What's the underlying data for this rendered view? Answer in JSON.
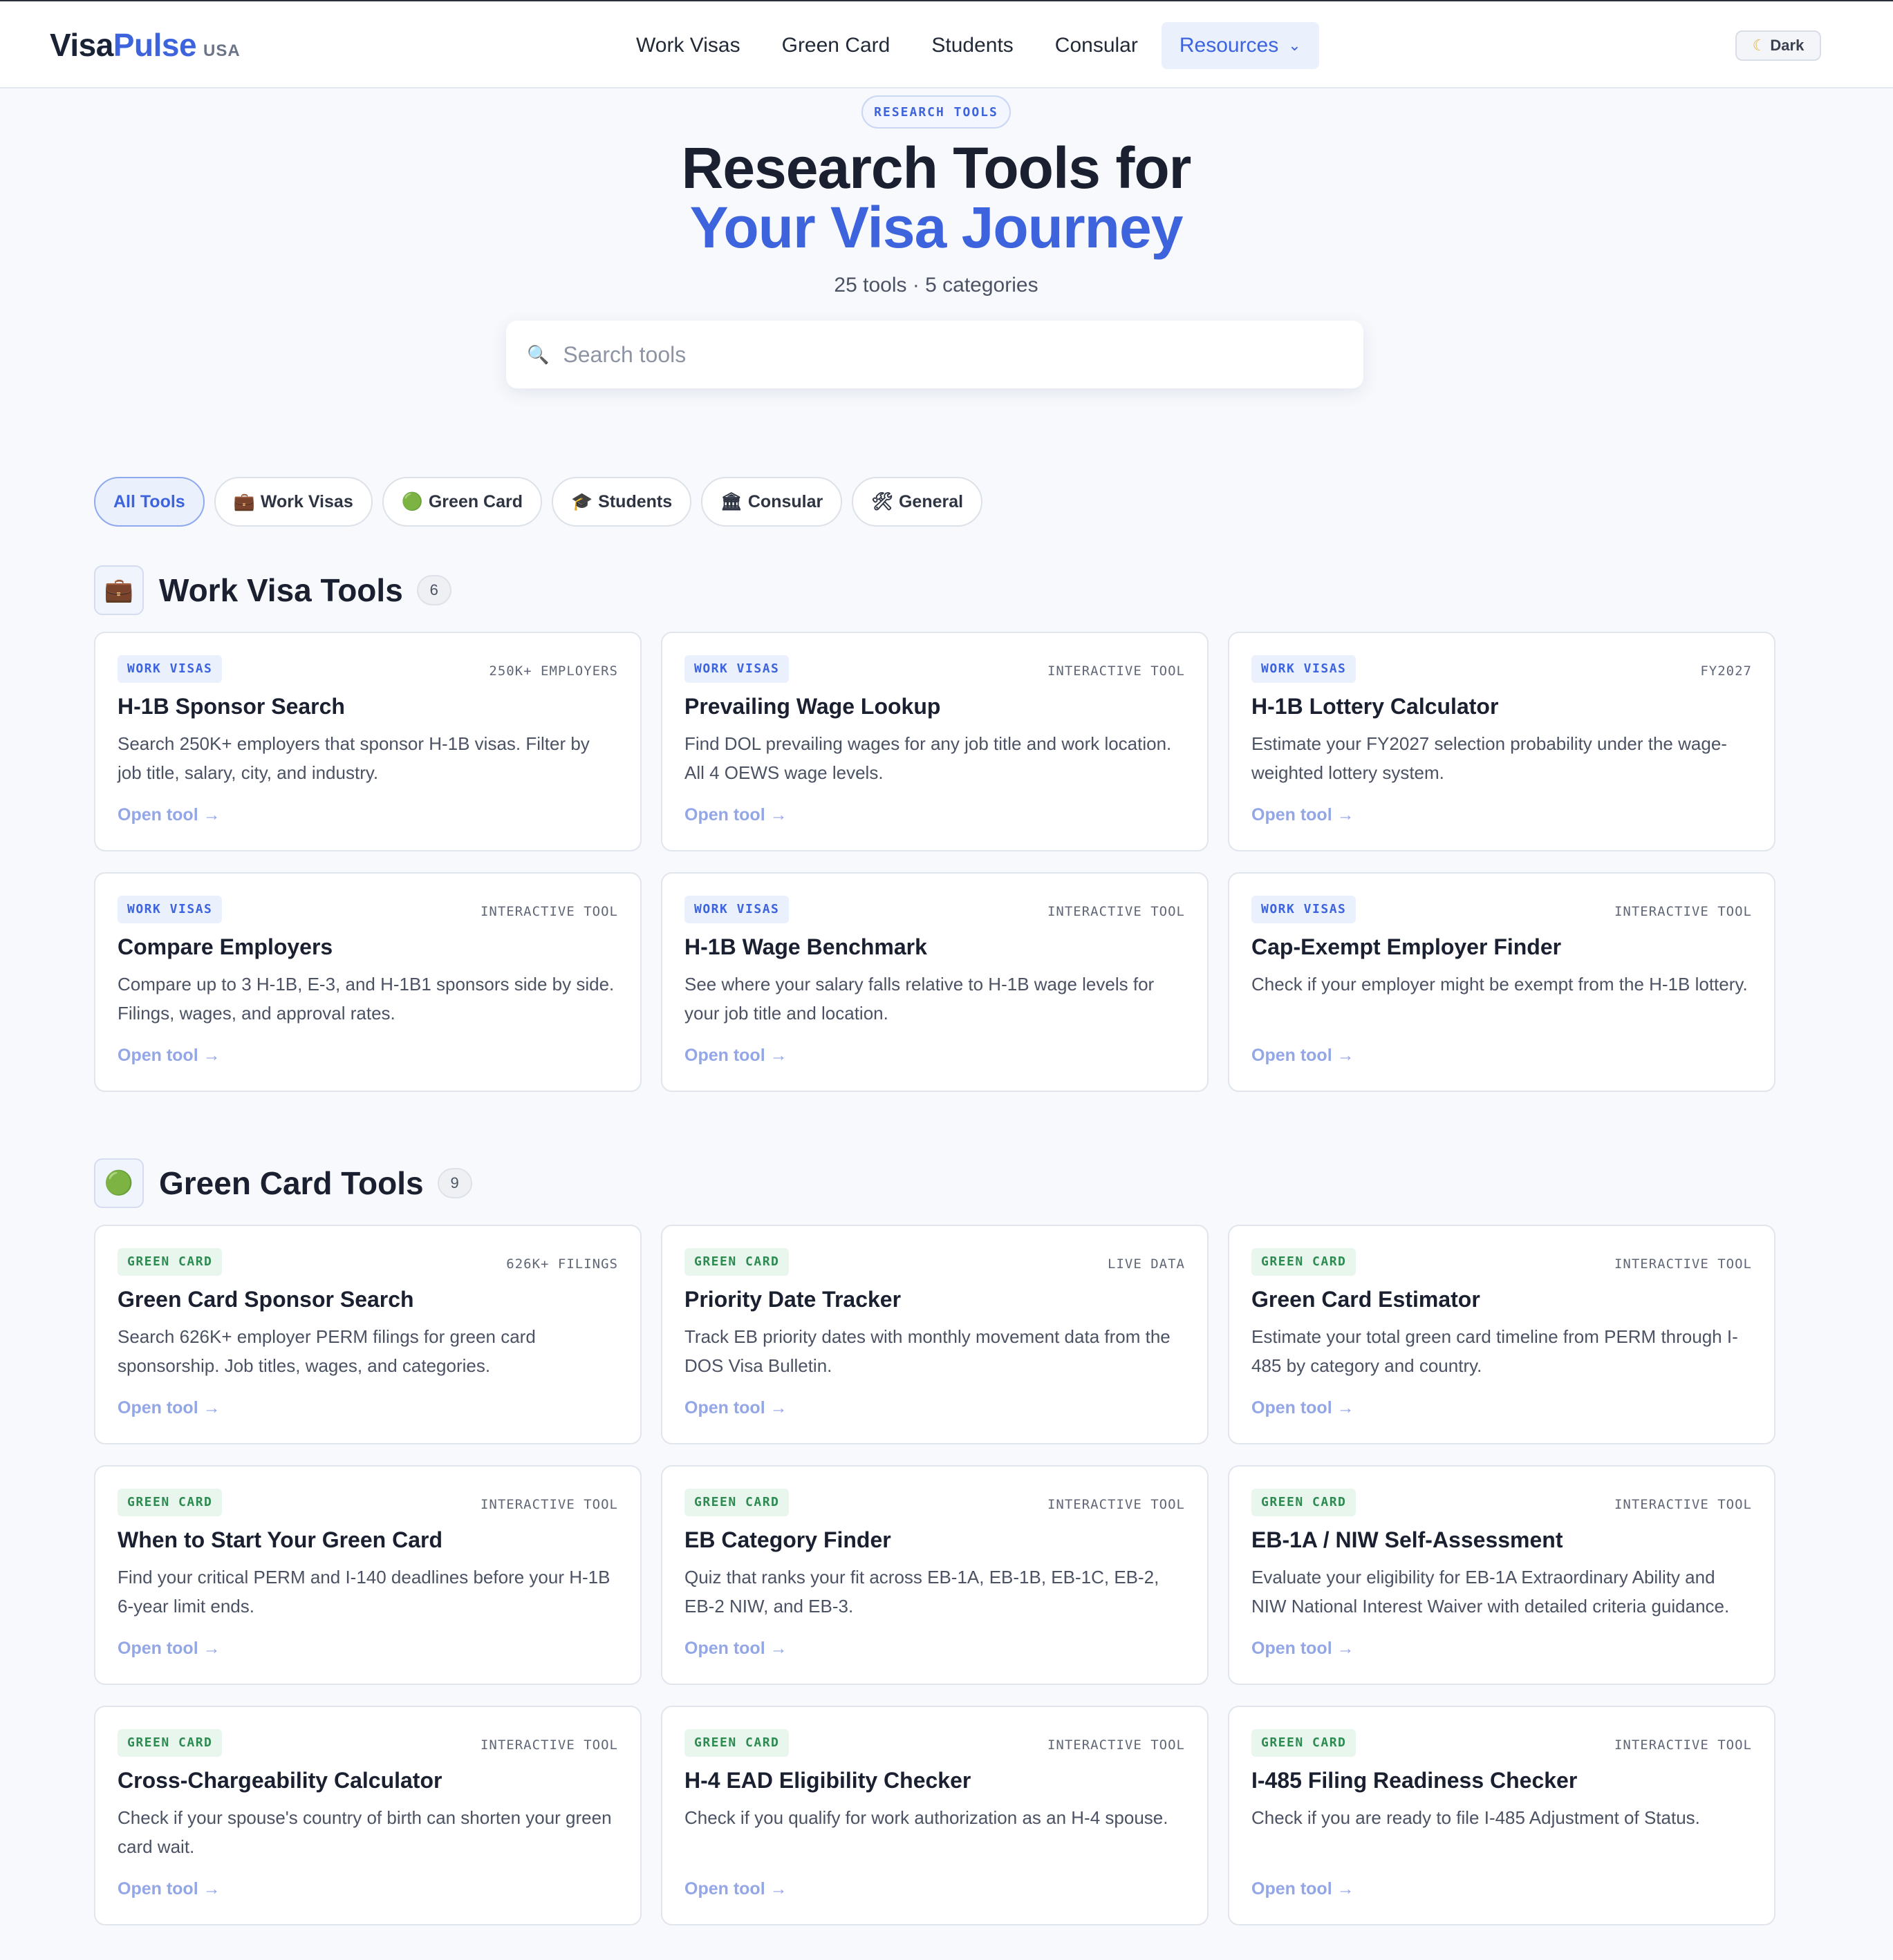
{
  "brand": {
    "name_a": "Visa",
    "name_b": "Pulse",
    "region": "USA"
  },
  "nav": {
    "items": [
      "Work Visas",
      "Green Card",
      "Students",
      "Consular"
    ],
    "resources": "Resources",
    "dark_toggle": "Dark"
  },
  "hero": {
    "pill": "RESEARCH TOOLS",
    "title_line1": "Research Tools for",
    "title_line2": "Your Visa Journey",
    "subtitle": "25 tools · 5 categories"
  },
  "search": {
    "placeholder": "Search tools"
  },
  "filters": [
    {
      "icon": "",
      "label": "All Tools",
      "active": true
    },
    {
      "icon": "💼",
      "label": "Work Visas",
      "active": false
    },
    {
      "icon": "🟢",
      "label": "Green Card",
      "active": false
    },
    {
      "icon": "🎓",
      "label": "Students",
      "active": false
    },
    {
      "icon": "🏛",
      "label": "Consular",
      "active": false
    },
    {
      "icon": "🛠",
      "label": "General",
      "active": false
    }
  ],
  "sections": [
    {
      "icon": "💼",
      "title": "Work Visa Tools",
      "count": "6",
      "cards": [
        {
          "tag": "WORK VISAS",
          "meta": "250K+ EMPLOYERS",
          "title": "H-1B Sponsor Search",
          "desc": "Search 250K+ employers that sponsor H-1B visas. Filter by job title, salary, city, and industry.",
          "link": "Open tool →"
        },
        {
          "tag": "WORK VISAS",
          "meta": "INTERACTIVE TOOL",
          "title": "Prevailing Wage Lookup",
          "desc": "Find DOL prevailing wages for any job title and work location. All 4 OEWS wage levels.",
          "link": "Open tool →"
        },
        {
          "tag": "WORK VISAS",
          "meta": "FY2027",
          "title": "H-1B Lottery Calculator",
          "desc": "Estimate your FY2027 selection probability under the wage-weighted lottery system.",
          "link": "Open tool →"
        },
        {
          "tag": "WORK VISAS",
          "meta": "INTERACTIVE TOOL",
          "title": "Compare Employers",
          "desc": "Compare up to 3 H-1B, E-3, and H-1B1 sponsors side by side. Filings, wages, and approval rates.",
          "link": "Open tool →"
        },
        {
          "tag": "WORK VISAS",
          "meta": "INTERACTIVE TOOL",
          "title": "H-1B Wage Benchmark",
          "desc": "See where your salary falls relative to H-1B wage levels for your job title and location.",
          "link": "Open tool →"
        },
        {
          "tag": "WORK VISAS",
          "meta": "INTERACTIVE TOOL",
          "title": "Cap-Exempt Employer Finder",
          "desc": "Check if your employer might be exempt from the H-1B lottery.",
          "link": "Open tool →"
        }
      ]
    },
    {
      "icon": "🟢",
      "title": "Green Card Tools",
      "count": "9",
      "cards": [
        {
          "tag": "GREEN CARD",
          "meta": "626K+ FILINGS",
          "title": "Green Card Sponsor Search",
          "desc": "Search 626K+ employer PERM filings for green card sponsorship. Job titles, wages, and categories.",
          "link": "Open tool →"
        },
        {
          "tag": "GREEN CARD",
          "meta": "LIVE DATA",
          "title": "Priority Date Tracker",
          "desc": "Track EB priority dates with monthly movement data from the DOS Visa Bulletin.",
          "link": "Open tool →"
        },
        {
          "tag": "GREEN CARD",
          "meta": "INTERACTIVE TOOL",
          "title": "Green Card Estimator",
          "desc": "Estimate your total green card timeline from PERM through I-485 by category and country.",
          "link": "Open tool →"
        },
        {
          "tag": "GREEN CARD",
          "meta": "INTERACTIVE TOOL",
          "title": "When to Start Your Green Card",
          "desc": "Find your critical PERM and I-140 deadlines before your H-1B 6-year limit ends.",
          "link": "Open tool →"
        },
        {
          "tag": "GREEN CARD",
          "meta": "INTERACTIVE TOOL",
          "title": "EB Category Finder",
          "desc": "Quiz that ranks your fit across EB-1A, EB-1B, EB-1C, EB-2, EB-2 NIW, and EB-3.",
          "link": "Open tool →"
        },
        {
          "tag": "GREEN CARD",
          "meta": "INTERACTIVE TOOL",
          "title": "EB-1A / NIW Self-Assessment",
          "desc": "Evaluate your eligibility for EB-1A Extraordinary Ability and NIW National Interest Waiver with detailed criteria guidance.",
          "link": "Open tool →"
        },
        {
          "tag": "GREEN CARD",
          "meta": "INTERACTIVE TOOL",
          "title": "Cross-Chargeability Calculator",
          "desc": "Check if your spouse's country of birth can shorten your green card wait.",
          "link": "Open tool →"
        },
        {
          "tag": "GREEN CARD",
          "meta": "INTERACTIVE TOOL",
          "title": "H-4 EAD Eligibility Checker",
          "desc": "Check if you qualify for work authorization as an H-4 spouse.",
          "link": "Open tool →"
        },
        {
          "tag": "GREEN CARD",
          "meta": "INTERACTIVE TOOL",
          "title": "I-485 Filing Readiness Checker",
          "desc": "Check if you are ready to file I-485 Adjustment of Status.",
          "link": "Open tool →"
        }
      ]
    }
  ]
}
